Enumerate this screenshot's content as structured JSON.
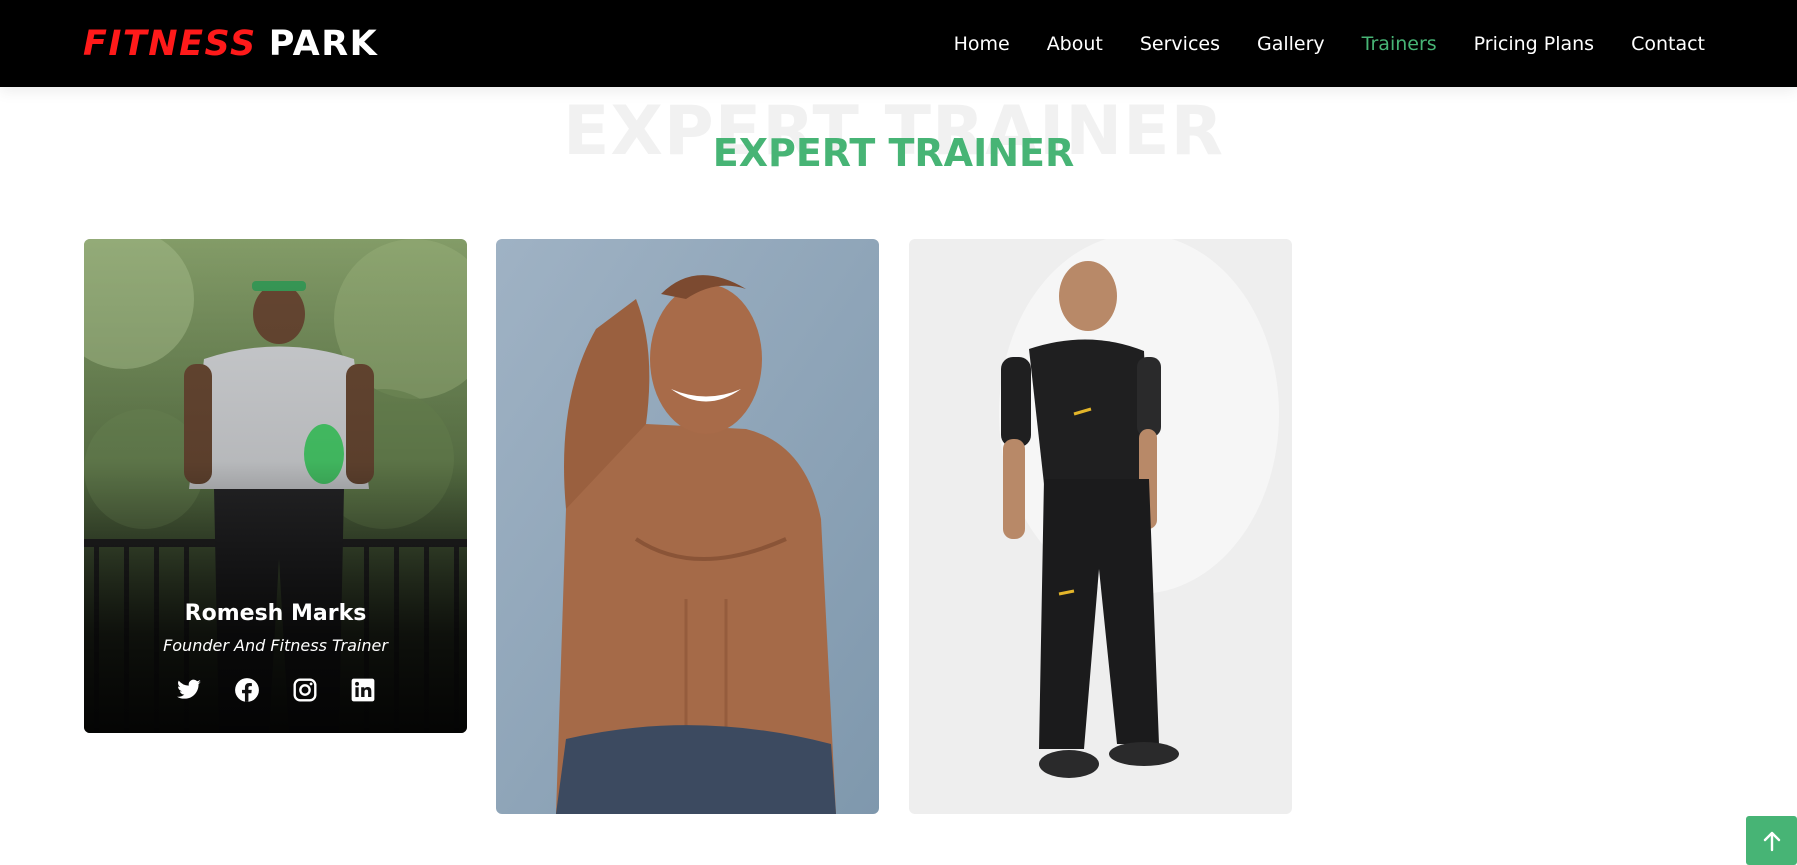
{
  "brand": {
    "part1": "FITNESS",
    "part2": "PARK",
    "accent_color": "#ff1a1a"
  },
  "nav": {
    "items": [
      {
        "label": "Home",
        "active": false
      },
      {
        "label": "About",
        "active": false
      },
      {
        "label": "Services",
        "active": false
      },
      {
        "label": "Gallery",
        "active": false
      },
      {
        "label": "Trainers",
        "active": true
      },
      {
        "label": "Pricing Plans",
        "active": false
      },
      {
        "label": "Contact",
        "active": false
      }
    ],
    "active_color": "#47b475"
  },
  "section": {
    "bg_title": "EXPERT TRAINER",
    "title": "EXPERT TRAINER",
    "title_color": "#47b475"
  },
  "trainers": [
    {
      "name": "Romesh Marks",
      "role": "Founder And Fitness Trainer",
      "photo": "trainer-outdoor-green-headband",
      "socials": [
        "twitter-icon",
        "facebook-icon",
        "instagram-icon",
        "linkedin-icon"
      ]
    },
    {
      "photo": "trainer-shirtless-blue-background"
    },
    {
      "photo": "trainer-black-sportswear-white-background"
    }
  ],
  "back_to_top": {
    "icon": "arrow-up-icon",
    "color": "#47b475"
  }
}
